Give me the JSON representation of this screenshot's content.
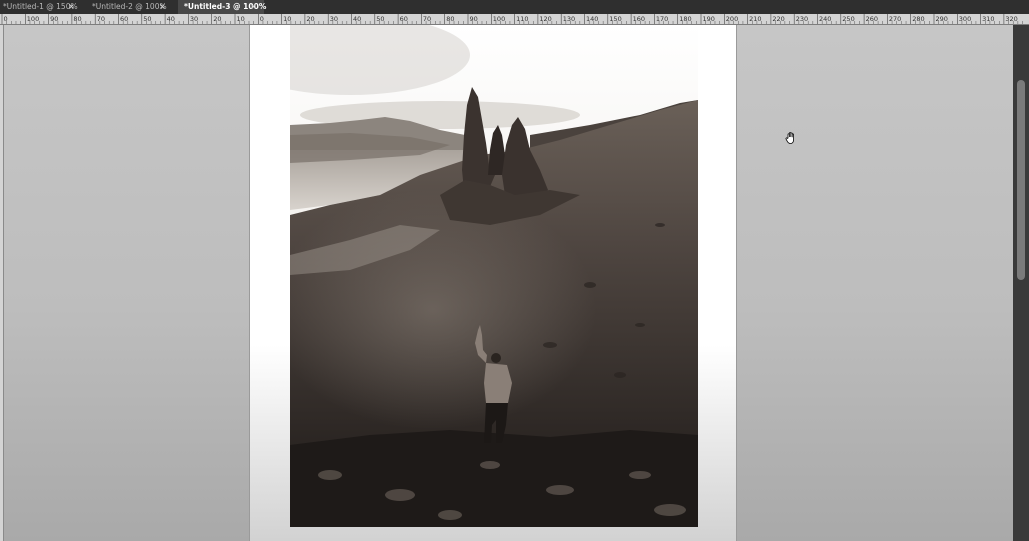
{
  "tabs": [
    {
      "label": "*Untitled-1 @ 150%",
      "close": "×",
      "active": false
    },
    {
      "label": "*Untitled-2 @ 100%",
      "close": "×",
      "active": false
    },
    {
      "label": "*Untitled-3 @ 100%",
      "close": "×",
      "active": true
    }
  ],
  "ruler": {
    "labels": [
      "0",
      "100",
      "90",
      "80",
      "70",
      "60",
      "50",
      "40",
      "30",
      "20",
      "10",
      "0",
      "10",
      "20",
      "30",
      "40",
      "50",
      "60",
      "70",
      "80",
      "90",
      "100",
      "110",
      "120",
      "130",
      "140",
      "150",
      "160",
      "170",
      "180",
      "190",
      "200",
      "210",
      "220",
      "230",
      "240",
      "250",
      "260",
      "270",
      "280",
      "290",
      "300",
      "310",
      "320"
    ]
  },
  "colors": {
    "tab_bar": "#2f2f2f",
    "active_tab": "#484848",
    "canvas_bg": "#c0c0c0",
    "page": "#ffffff",
    "scrollbar": "#3a3a3a"
  },
  "icons": {
    "cursor": "hand-icon"
  }
}
